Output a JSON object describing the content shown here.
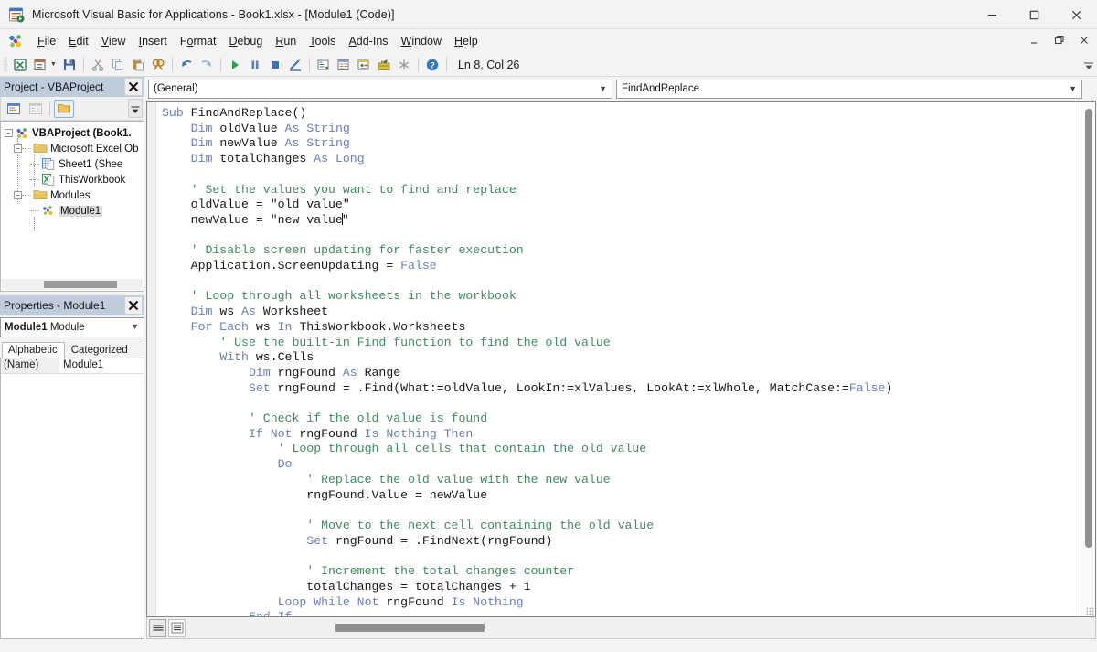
{
  "window": {
    "title": "Microsoft Visual Basic for Applications - Book1.xlsx - [Module1 (Code)]",
    "app_icon": "vba-app-icon",
    "controls": {
      "minimize": "minimize-icon",
      "maximize": "maximize-icon",
      "close": "close-icon"
    },
    "mdi_controls": {
      "minimize": "mdi-minimize-icon",
      "restore": "mdi-restore-icon",
      "close": "mdi-close-icon"
    }
  },
  "menubar": {
    "logo": "vba-logo-icon",
    "items": [
      {
        "label": "File",
        "accel": "F"
      },
      {
        "label": "Edit",
        "accel": "E"
      },
      {
        "label": "View",
        "accel": "V"
      },
      {
        "label": "Insert",
        "accel": "I"
      },
      {
        "label": "Format",
        "accel": "o"
      },
      {
        "label": "Debug",
        "accel": "D"
      },
      {
        "label": "Run",
        "accel": "R"
      },
      {
        "label": "Tools",
        "accel": "T"
      },
      {
        "label": "Add-Ins",
        "accel": "A"
      },
      {
        "label": "Window",
        "accel": "W"
      },
      {
        "label": "Help",
        "accel": "H"
      }
    ]
  },
  "toolbar": {
    "buttons": [
      {
        "name": "view-excel-icon",
        "title": "View Microsoft Excel"
      },
      {
        "name": "insert-userform-icon",
        "title": "Insert UserForm"
      },
      {
        "name": "save-icon",
        "title": "Save Book1.xlsx"
      },
      {
        "name": "cut-icon",
        "title": "Cut"
      },
      {
        "name": "copy-icon",
        "title": "Copy"
      },
      {
        "name": "paste-icon",
        "title": "Paste"
      },
      {
        "name": "find-icon",
        "title": "Find"
      },
      {
        "name": "undo-icon",
        "title": "Undo"
      },
      {
        "name": "redo-icon",
        "title": "Redo"
      },
      {
        "name": "run-icon",
        "title": "Run Sub/UserForm"
      },
      {
        "name": "pause-icon",
        "title": "Break"
      },
      {
        "name": "stop-icon",
        "title": "Reset"
      },
      {
        "name": "design-mode-icon",
        "title": "Design Mode"
      },
      {
        "name": "project-explorer-icon",
        "title": "Project Explorer"
      },
      {
        "name": "properties-window-icon",
        "title": "Properties Window"
      },
      {
        "name": "object-browser-icon",
        "title": "Object Browser"
      },
      {
        "name": "toolbox-icon",
        "title": "Toolbox"
      },
      {
        "name": "help-icon",
        "title": "Microsoft Visual Basic for Applications Help"
      }
    ],
    "status": "Ln 8, Col 26",
    "overflow": "toolbar-overflow-icon"
  },
  "project_explorer": {
    "title": "Project - VBAProject",
    "close": "close-icon",
    "toolbar": [
      {
        "name": "view-code-icon",
        "title": "View Code",
        "state": "enabled"
      },
      {
        "name": "view-object-icon",
        "title": "View Object",
        "state": "disabled"
      },
      {
        "name": "toggle-folders-icon",
        "title": "Toggle Folders",
        "state": "active"
      }
    ],
    "tree": [
      {
        "label": "VBAProject (Book1.",
        "icon": "vbaproject-icon",
        "level": 0,
        "expander": "-",
        "bold": true,
        "selected": false
      },
      {
        "label": "Microsoft Excel Ob",
        "icon": "folder-icon",
        "level": 1,
        "expander": "-",
        "bold": false,
        "selected": false
      },
      {
        "label": "Sheet1 (Shee",
        "icon": "worksheet-icon",
        "level": 2,
        "expander": "",
        "bold": false,
        "selected": false
      },
      {
        "label": "ThisWorkbook",
        "icon": "workbook-icon",
        "level": 2,
        "expander": "",
        "bold": false,
        "selected": false
      },
      {
        "label": "Modules",
        "icon": "folder-icon",
        "level": 1,
        "expander": "-",
        "bold": false,
        "selected": false
      },
      {
        "label": "Module1",
        "icon": "module-icon",
        "level": 2,
        "expander": "",
        "bold": false,
        "selected": true
      }
    ]
  },
  "properties": {
    "title": "Properties - Module1",
    "close": "close-icon",
    "selected_object": {
      "name": "Module1",
      "type": "Module"
    },
    "caret": "chevron-down-icon",
    "tabs": [
      {
        "label": "Alphabetic",
        "active": true
      },
      {
        "label": "Categorized",
        "active": false
      }
    ],
    "rows": [
      {
        "key": "(Name)",
        "value": "Module1"
      }
    ]
  },
  "code_window": {
    "object_dropdown": {
      "value": "(General)",
      "caret": "chevron-down-icon"
    },
    "proc_dropdown": {
      "value": "FindAndReplace",
      "caret": "chevron-down-icon"
    },
    "view_buttons": [
      {
        "name": "procedure-view-icon",
        "title": "Procedure View",
        "active": true
      },
      {
        "name": "full-module-view-icon",
        "title": "Full Module View",
        "active": false
      }
    ],
    "code_lines": [
      [
        {
          "t": "Sub",
          "c": "k"
        },
        {
          "t": " FindAndReplace()",
          "c": "s"
        }
      ],
      [
        {
          "t": "    ",
          "c": "s"
        },
        {
          "t": "Dim",
          "c": "k"
        },
        {
          "t": " oldValue ",
          "c": "s"
        },
        {
          "t": "As",
          "c": "k"
        },
        {
          "t": " ",
          "c": "s"
        },
        {
          "t": "String",
          "c": "k"
        }
      ],
      [
        {
          "t": "    ",
          "c": "s"
        },
        {
          "t": "Dim",
          "c": "k"
        },
        {
          "t": " newValue ",
          "c": "s"
        },
        {
          "t": "As",
          "c": "k"
        },
        {
          "t": " ",
          "c": "s"
        },
        {
          "t": "String",
          "c": "k"
        }
      ],
      [
        {
          "t": "    ",
          "c": "s"
        },
        {
          "t": "Dim",
          "c": "k"
        },
        {
          "t": " totalChanges ",
          "c": "s"
        },
        {
          "t": "As",
          "c": "k"
        },
        {
          "t": " ",
          "c": "s"
        },
        {
          "t": "Long",
          "c": "k"
        }
      ],
      [],
      [
        {
          "t": "    ' Set the values you want to find and replace",
          "c": "c"
        }
      ],
      [
        {
          "t": "    oldValue = \"old value\"",
          "c": "s"
        }
      ],
      [
        {
          "t": "    newValue = \"new value",
          "c": "s"
        },
        {
          "t": "|CARET|",
          "c": "caret"
        },
        {
          "t": "\"",
          "c": "s"
        }
      ],
      [],
      [
        {
          "t": "    ' Disable screen updating for faster execution",
          "c": "c"
        }
      ],
      [
        {
          "t": "    Application.ScreenUpdating = ",
          "c": "s"
        },
        {
          "t": "False",
          "c": "k"
        }
      ],
      [],
      [
        {
          "t": "    ' Loop through all worksheets in the workbook",
          "c": "c"
        }
      ],
      [
        {
          "t": "    ",
          "c": "s"
        },
        {
          "t": "Dim",
          "c": "k"
        },
        {
          "t": " ws ",
          "c": "s"
        },
        {
          "t": "As",
          "c": "k"
        },
        {
          "t": " Worksheet",
          "c": "s"
        }
      ],
      [
        {
          "t": "    ",
          "c": "s"
        },
        {
          "t": "For Each",
          "c": "k"
        },
        {
          "t": " ws ",
          "c": "s"
        },
        {
          "t": "In",
          "c": "k"
        },
        {
          "t": " ThisWorkbook.Worksheets",
          "c": "s"
        }
      ],
      [
        {
          "t": "        ' Use the built-in Find function to find the old value",
          "c": "c"
        }
      ],
      [
        {
          "t": "        ",
          "c": "s"
        },
        {
          "t": "With",
          "c": "k"
        },
        {
          "t": " ws.Cells",
          "c": "s"
        }
      ],
      [
        {
          "t": "            ",
          "c": "s"
        },
        {
          "t": "Dim",
          "c": "k"
        },
        {
          "t": " rngFound ",
          "c": "s"
        },
        {
          "t": "As",
          "c": "k"
        },
        {
          "t": " Range",
          "c": "s"
        }
      ],
      [
        {
          "t": "            ",
          "c": "s"
        },
        {
          "t": "Set",
          "c": "k"
        },
        {
          "t": " rngFound = .Find(What:=oldValue, LookIn:=xlValues, LookAt:=xlWhole, MatchCase:=",
          "c": "s"
        },
        {
          "t": "False",
          "c": "k"
        },
        {
          "t": ")",
          "c": "s"
        }
      ],
      [],
      [
        {
          "t": "            ' Check if the old value is found",
          "c": "c"
        }
      ],
      [
        {
          "t": "            ",
          "c": "s"
        },
        {
          "t": "If Not",
          "c": "k"
        },
        {
          "t": " rngFound ",
          "c": "s"
        },
        {
          "t": "Is Nothing Then",
          "c": "k"
        }
      ],
      [
        {
          "t": "                ' Loop through all cells that contain the old value",
          "c": "c"
        }
      ],
      [
        {
          "t": "                ",
          "c": "s"
        },
        {
          "t": "Do",
          "c": "k"
        }
      ],
      [
        {
          "t": "                    ' Replace the old value with the new value",
          "c": "c"
        }
      ],
      [
        {
          "t": "                    rngFound.Value = newValue",
          "c": "s"
        }
      ],
      [],
      [
        {
          "t": "                    ' Move to the next cell containing the old value",
          "c": "c"
        }
      ],
      [
        {
          "t": "                    ",
          "c": "s"
        },
        {
          "t": "Set",
          "c": "k"
        },
        {
          "t": " rngFound = .FindNext(rngFound)",
          "c": "s"
        }
      ],
      [],
      [
        {
          "t": "                    ' Increment the total changes counter",
          "c": "c"
        }
      ],
      [
        {
          "t": "                    totalChanges = totalChanges + 1",
          "c": "s"
        }
      ],
      [
        {
          "t": "                ",
          "c": "s"
        },
        {
          "t": "Loop While Not",
          "c": "k"
        },
        {
          "t": " rngFound ",
          "c": "s"
        },
        {
          "t": "Is Nothing",
          "c": "k"
        }
      ],
      [
        {
          "t": "            ",
          "c": "s"
        },
        {
          "t": "End If",
          "c": "k"
        }
      ]
    ]
  },
  "colors": {
    "keyword": "#6a7fb9",
    "comment": "#3f8a62",
    "text": "#141414",
    "dock_title_bg": "#bfcddb",
    "app_bg": "#f3f3f3"
  }
}
